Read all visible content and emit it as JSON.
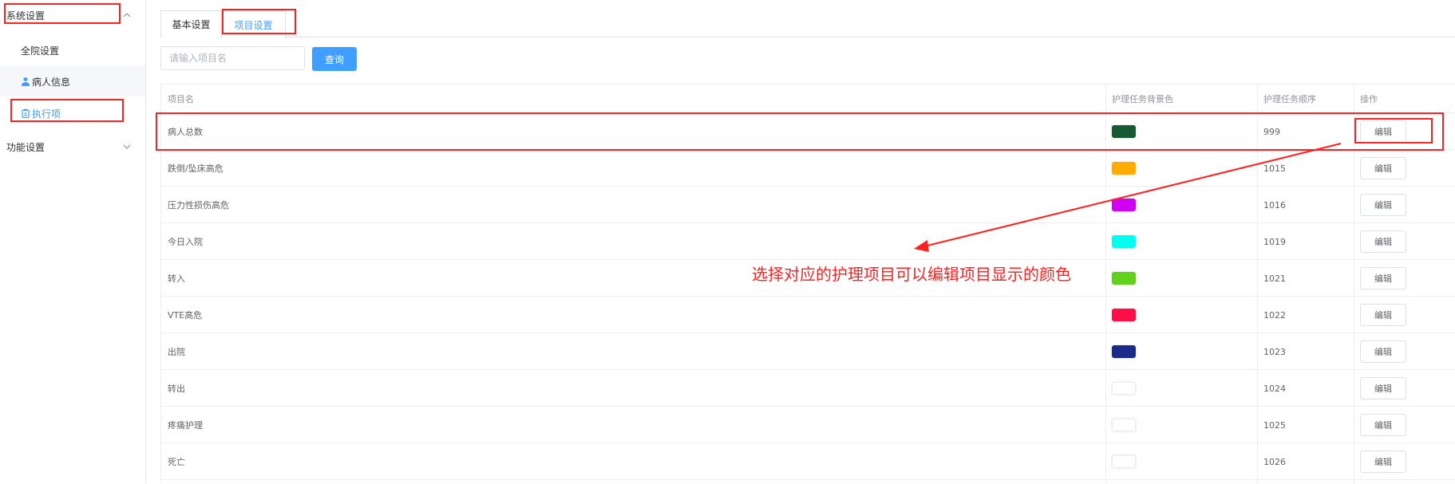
{
  "sidebar": {
    "groups": [
      {
        "label": "系统设置"
      },
      {
        "label": "功能设置"
      }
    ],
    "items": [
      {
        "label": "全院设置"
      },
      {
        "label": "病人信息"
      },
      {
        "label": "执行项"
      }
    ]
  },
  "tabs": [
    {
      "label": "基本设置"
    },
    {
      "label": "项目设置"
    }
  ],
  "search": {
    "placeholder": "请输入项目名",
    "button_label": "查询"
  },
  "table": {
    "headers": [
      "项目名",
      "护理任务背景色",
      "护理任务顺序",
      "操作"
    ],
    "edit_label": "编辑",
    "rows": [
      {
        "name": "病人总数",
        "color": "#155a32",
        "order": "999"
      },
      {
        "name": "跌倒/坠床高危",
        "color": "#ffab00",
        "order": "1015"
      },
      {
        "name": "压力性损伤高危",
        "color": "#cf00f5",
        "order": "1016"
      },
      {
        "name": "今日入院",
        "color": "#00fff0",
        "order": "1019"
      },
      {
        "name": "转入",
        "color": "#62d11d",
        "order": "1021"
      },
      {
        "name": "VTE高危",
        "color": "#ff0f48",
        "order": "1022"
      },
      {
        "name": "出院",
        "color": "#1a2b8a",
        "order": "1023"
      },
      {
        "name": "转出",
        "color": "#ffffff",
        "order": "1024"
      },
      {
        "name": "疼痛护理",
        "color": "#ffffff",
        "order": "1025"
      },
      {
        "name": "死亡",
        "color": "#ffffff",
        "order": "1026"
      }
    ]
  },
  "annotation": {
    "text": "选择对应的护理项目可以编辑项目显示的颜色",
    "color": "#ff2020"
  }
}
